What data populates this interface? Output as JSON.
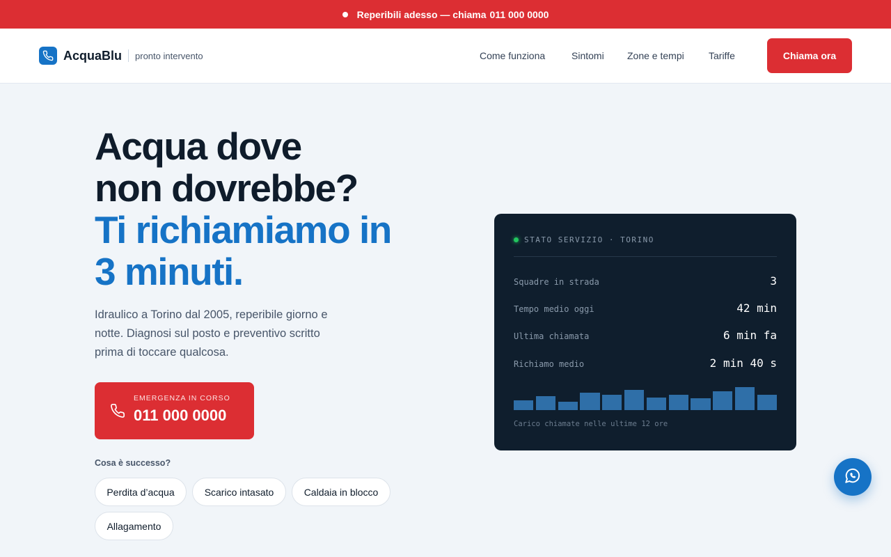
{
  "topbar": {
    "text": "Reperibili adesso — chiama",
    "phone": "011 000 0000"
  },
  "brand": {
    "name": "AcquaBlu",
    "tagline": "pronto intervento",
    "icon": "phone-icon"
  },
  "nav": [
    {
      "label": "Come funziona"
    },
    {
      "label": "Sintomi"
    },
    {
      "label": "Zone e tempi"
    },
    {
      "label": "Tariffe"
    }
  ],
  "nav_cta": {
    "label": "Chiama ora"
  },
  "hero": {
    "line1": "Acqua dove",
    "line2": "non dovrebbe?",
    "line3": "Ti richiamiamo in",
    "line4": "3 minuti.",
    "intro": "Idraulico a Torino dal 2005, reperibile giorno e notte. Diagnosi sul posto e preventivo scritto prima di toccare qualcosa."
  },
  "emergency": {
    "label": "EMERGENZA IN CORSO",
    "number": "011 000 0000",
    "icon": "phone-icon"
  },
  "issues": {
    "question": "Cosa è successo?",
    "chips": [
      "Perdita d’acqua",
      "Scarico intasato",
      "Caldaia in blocco",
      "Allagamento"
    ]
  },
  "panel": {
    "status": "STATO SERVIZIO · TORINO",
    "stats": [
      {
        "label": "Squadre in strada",
        "value": "3"
      },
      {
        "label": "Tempo medio oggi",
        "value": "42 min"
      },
      {
        "label": "Ultima chiamata",
        "value": "6 min fa"
      },
      {
        "label": "Richiamo medio",
        "value": "2 min 40 s"
      }
    ],
    "load": [
      0.4,
      0.55,
      0.32,
      0.7,
      0.62,
      0.8,
      0.5,
      0.62,
      0.48,
      0.75,
      0.92,
      0.6
    ],
    "caption": "Carico chiamate nelle ultime 12 ore"
  },
  "fab": {
    "icon": "whatsapp-icon"
  },
  "colors": {
    "red": "#dc2e33",
    "blue": "#1673c6",
    "navy": "#0f1e2d",
    "green": "#22c55e"
  }
}
